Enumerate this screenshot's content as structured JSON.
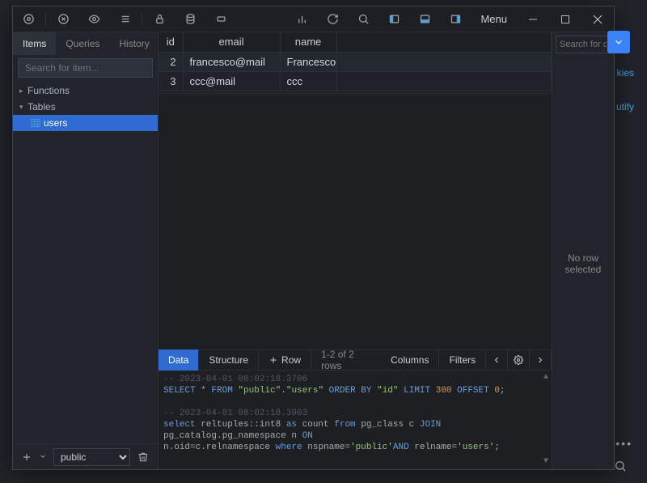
{
  "bg_links": {
    "link1": "kies",
    "link2": "utify"
  },
  "titlebar": {
    "menu": "Menu"
  },
  "sidebar": {
    "tabs": [
      "Items",
      "Queries",
      "History"
    ],
    "active_tab": 0,
    "search_placeholder": "Search for item...",
    "tree": {
      "functions": "Functions",
      "tables": "Tables",
      "table_items": [
        "users"
      ]
    },
    "schema_select": "public"
  },
  "table": {
    "columns": [
      "id",
      "email",
      "name"
    ],
    "rows": [
      {
        "id": "2",
        "email": "francesco@mail",
        "name": "Francesco"
      },
      {
        "id": "3",
        "email": "ccc@mail",
        "name": "ccc"
      }
    ]
  },
  "bottom_toolbar": {
    "data": "Data",
    "structure": "Structure",
    "row": "Row",
    "info": "1-2 of 2 rows",
    "columns": "Columns",
    "filters": "Filters"
  },
  "sql": {
    "l1_ts": "-- 2023-04-01 08:02:18.3706",
    "l2_a": "SELECT",
    "l2_b": " * ",
    "l2_c": "FROM",
    "l2_d": " \"public\"",
    "l2_e": ".",
    "l2_f": "\"users\"",
    "l2_g": " ORDER BY ",
    "l2_h": "\"id\"",
    "l2_i": " LIMIT ",
    "l2_j": "300",
    "l2_k": " OFFSET ",
    "l2_l": "0",
    "l2_m": ";",
    "l3_ts": "-- 2023-04-01 08:02:18.3903",
    "l4_a": "select",
    "l4_b": " reltuples::int8 ",
    "l4_c": "as",
    "l4_d": " count ",
    "l4_e": "from",
    "l4_f": " pg_class c ",
    "l4_g": "JOIN",
    "l4_h": " pg_catalog.pg_namespace n ",
    "l4_i": "ON",
    "l5_a": "n.oid=c.relnamespace ",
    "l5_b": "where",
    "l5_c": " nspname=",
    "l5_d": "'public'",
    "l5_e": "AND",
    "l5_f": " relname=",
    "l5_g": "'users'",
    "l5_h": ";"
  },
  "rightpanel": {
    "search_placeholder": "Search for col",
    "msg": "No row selected"
  }
}
